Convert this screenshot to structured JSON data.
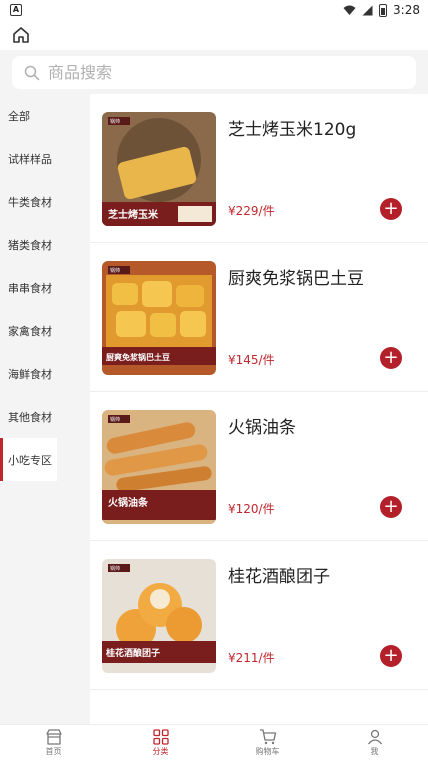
{
  "status": {
    "time": "3:28"
  },
  "search": {
    "placeholder": "商品搜索"
  },
  "sidebar": {
    "items": [
      {
        "label": "全部"
      },
      {
        "label": "试样样品"
      },
      {
        "label": "牛类食材"
      },
      {
        "label": "猪类食材"
      },
      {
        "label": "串串食材"
      },
      {
        "label": "家禽食材"
      },
      {
        "label": "海鲜食材"
      },
      {
        "label": "其他食材"
      },
      {
        "label": "小吃专区"
      }
    ],
    "active_index": 8
  },
  "products": [
    {
      "name": "芝士烤玉米120g",
      "price": "¥229/件",
      "image_caption": "芝士烤玉米",
      "image_brand": "锅帅",
      "colors": {
        "bg": "#8a6a4a",
        "food": "#e8b64a"
      }
    },
    {
      "name": "厨爽免浆锅巴土豆",
      "price": "¥145/件",
      "image_caption": "厨爽免浆锅巴土豆",
      "image_brand": "锅帅",
      "colors": {
        "bg": "#b5582a",
        "food": "#f0b33a"
      }
    },
    {
      "name": "火锅油条",
      "price": "¥120/件",
      "image_caption": "火锅油条",
      "image_brand": "锅帅",
      "colors": {
        "bg": "#d9b380",
        "food": "#d98a3a"
      }
    },
    {
      "name": "桂花酒酿团子",
      "price": "¥211/件",
      "image_caption": "桂花酒酿团子",
      "image_brand": "锅帅",
      "colors": {
        "bg": "#e6e0d6",
        "food": "#f0a23a"
      }
    }
  ],
  "tabs": [
    {
      "label": "首页",
      "icon": "store-icon"
    },
    {
      "label": "分类",
      "icon": "grid-icon"
    },
    {
      "label": "购物车",
      "icon": "cart-icon"
    },
    {
      "label": "我",
      "icon": "person-icon"
    }
  ],
  "colors": {
    "accent": "#c0272d",
    "add_button": "#b3202a"
  }
}
